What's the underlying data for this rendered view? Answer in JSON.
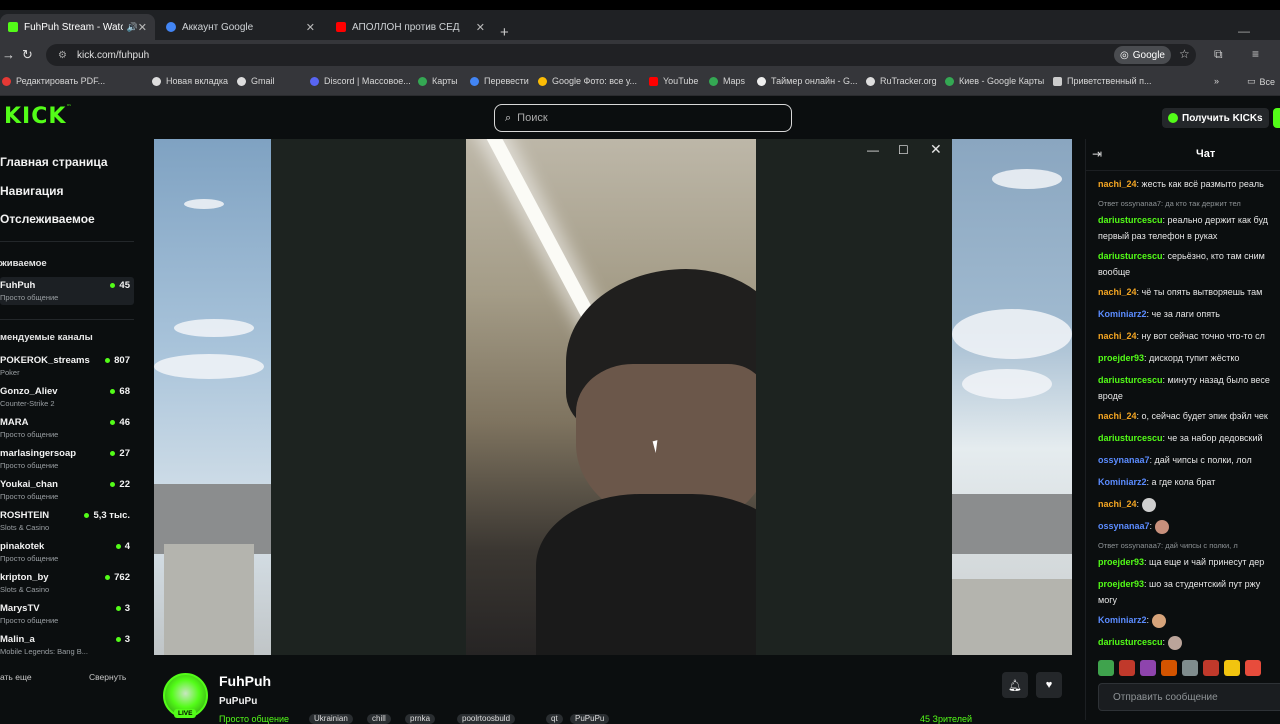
{
  "browser": {
    "tabs": [
      {
        "title": "FuhPuh Stream - Watch Liv",
        "active": true
      },
      {
        "title": "Аккаунт Google",
        "active": false
      },
      {
        "title": "АПОЛЛОН против СЕДОГО (п",
        "active": false
      }
    ],
    "url": "kick.com/fuhpuh",
    "google_badge": "Google",
    "bookmarks": [
      "Редактировать PDF...",
      "Новая вкладка",
      "Gmail",
      "Discord | Массовое...",
      "Карты",
      "Перевести",
      "Google Фото: все у...",
      "YouTube",
      "Maps",
      "Таймер онлайн - G...",
      "RuTracker.org",
      "Киев - Google Карты",
      "Приветственный п..."
    ],
    "bookmarks_all": "Все"
  },
  "header": {
    "logo": "KICK",
    "search_placeholder": "Поиск",
    "get_kicks": "Получить KICKs"
  },
  "sidebar": {
    "main_nav": [
      "Главная страница",
      "Навигация",
      "Отслеживаемое"
    ],
    "followed_title": "живаемое",
    "followed": [
      {
        "name": "FuhPuh",
        "category": "Просто общение",
        "viewers": "45"
      }
    ],
    "recommended_title": "мендуемые каналы",
    "recommended": [
      {
        "name": "POKEROK_streams",
        "category": "Poker",
        "viewers": "807"
      },
      {
        "name": "Gonzo_Aliev",
        "category": "Counter-Strike 2",
        "viewers": "68"
      },
      {
        "name": "MARA",
        "category": "Просто общение",
        "viewers": "46"
      },
      {
        "name": "marlasingersoap",
        "category": "Просто общение",
        "viewers": "27"
      },
      {
        "name": "Youkai_chan",
        "category": "Просто общение",
        "viewers": "22"
      },
      {
        "name": "ROSHTEIN",
        "category": "Slots & Casino",
        "viewers": "5,3 тыс."
      },
      {
        "name": "pinakotek",
        "category": "Просто общение",
        "viewers": "4"
      },
      {
        "name": "kripton_by",
        "category": "Slots & Casino",
        "viewers": "762"
      },
      {
        "name": "MarysTV",
        "category": "Просто общение",
        "viewers": "3"
      },
      {
        "name": "Malin_a",
        "category": "Mobile Legends: Bang B...",
        "viewers": "3"
      }
    ],
    "show_more": "ать еще",
    "collapse": "Свернуть"
  },
  "stream": {
    "channel": "FuhPuh",
    "title": "PuPuPu",
    "category": "Просто общение",
    "tags": [
      "Ukrainian",
      "chill",
      "prnka",
      "poolrtoosbuld",
      "qt",
      "PuPuPu"
    ],
    "live_label": "LIVE",
    "viewers_text": "45 Зрителей"
  },
  "chat": {
    "title": "Чат",
    "input_placeholder": "Отправить сообщение",
    "colors": {
      "orange": "#f5a623",
      "green": "#53fc18",
      "blue": "#5b8cff",
      "pink": "#ff6bcb",
      "grey": "#8e9396"
    }
  },
  "chat_messages": [
    {
      "user": "nachi_24",
      "color": "orange",
      "text": "жесть как всё размыто реаль"
    },
    {
      "reply": "Ответ ossynanaa7: да кто так держит тел"
    },
    {
      "user": "dariusturcescu",
      "color": "green",
      "text": "реально держит как буд"
    },
    {
      "cont": "первый раз телефон в руках"
    },
    {
      "user": "dariusturcescu",
      "color": "green",
      "text": "серьёзно, кто там сним"
    },
    {
      "cont": "вообще"
    },
    {
      "user": "nachi_24",
      "color": "orange",
      "text": "чё ты опять вытворяешь там"
    },
    {
      "user": "Kominiarz2",
      "color": "blue",
      "text": "че за лаги опять"
    },
    {
      "user": "nachi_24",
      "color": "orange",
      "text": "ну вот сейчас точно что-то сл"
    },
    {
      "user": "proejder93",
      "color": "green",
      "text": "дискорд тупит жёстко"
    },
    {
      "user": "dariusturcescu",
      "color": "green",
      "text": "минуту назад было весе"
    },
    {
      "cont": "вроде"
    },
    {
      "user": "nachi_24",
      "color": "orange",
      "text": "о, сейчас будет эпик фэйл чек"
    },
    {
      "user": "dariusturcescu",
      "color": "green",
      "text": "че за набор дедовский"
    },
    {
      "user": "ossynanaa7",
      "color": "blue",
      "text": "дай чипсы с полки, лол"
    },
    {
      "user": "Kominiarz2",
      "color": "blue",
      "text": "а где кола брат"
    },
    {
      "user": "nachi_24",
      "color": "orange",
      "text": ""
    },
    {
      "user": "ossynanaa7",
      "color": "blue",
      "text": ""
    },
    {
      "reply": "Ответ ossynanaa7: дай чипсы с полки, л"
    },
    {
      "user": "proejder93",
      "color": "green",
      "text": "ща еще и чай принесут дер"
    },
    {
      "user": "proejder93",
      "color": "green",
      "text": "шо за студентский пут ржу"
    },
    {
      "cont": "могу"
    },
    {
      "user": "Kominiarz2",
      "color": "blue",
      "text": ""
    },
    {
      "user": "dariusturcescu",
      "color": "green",
      "text": ""
    }
  ]
}
